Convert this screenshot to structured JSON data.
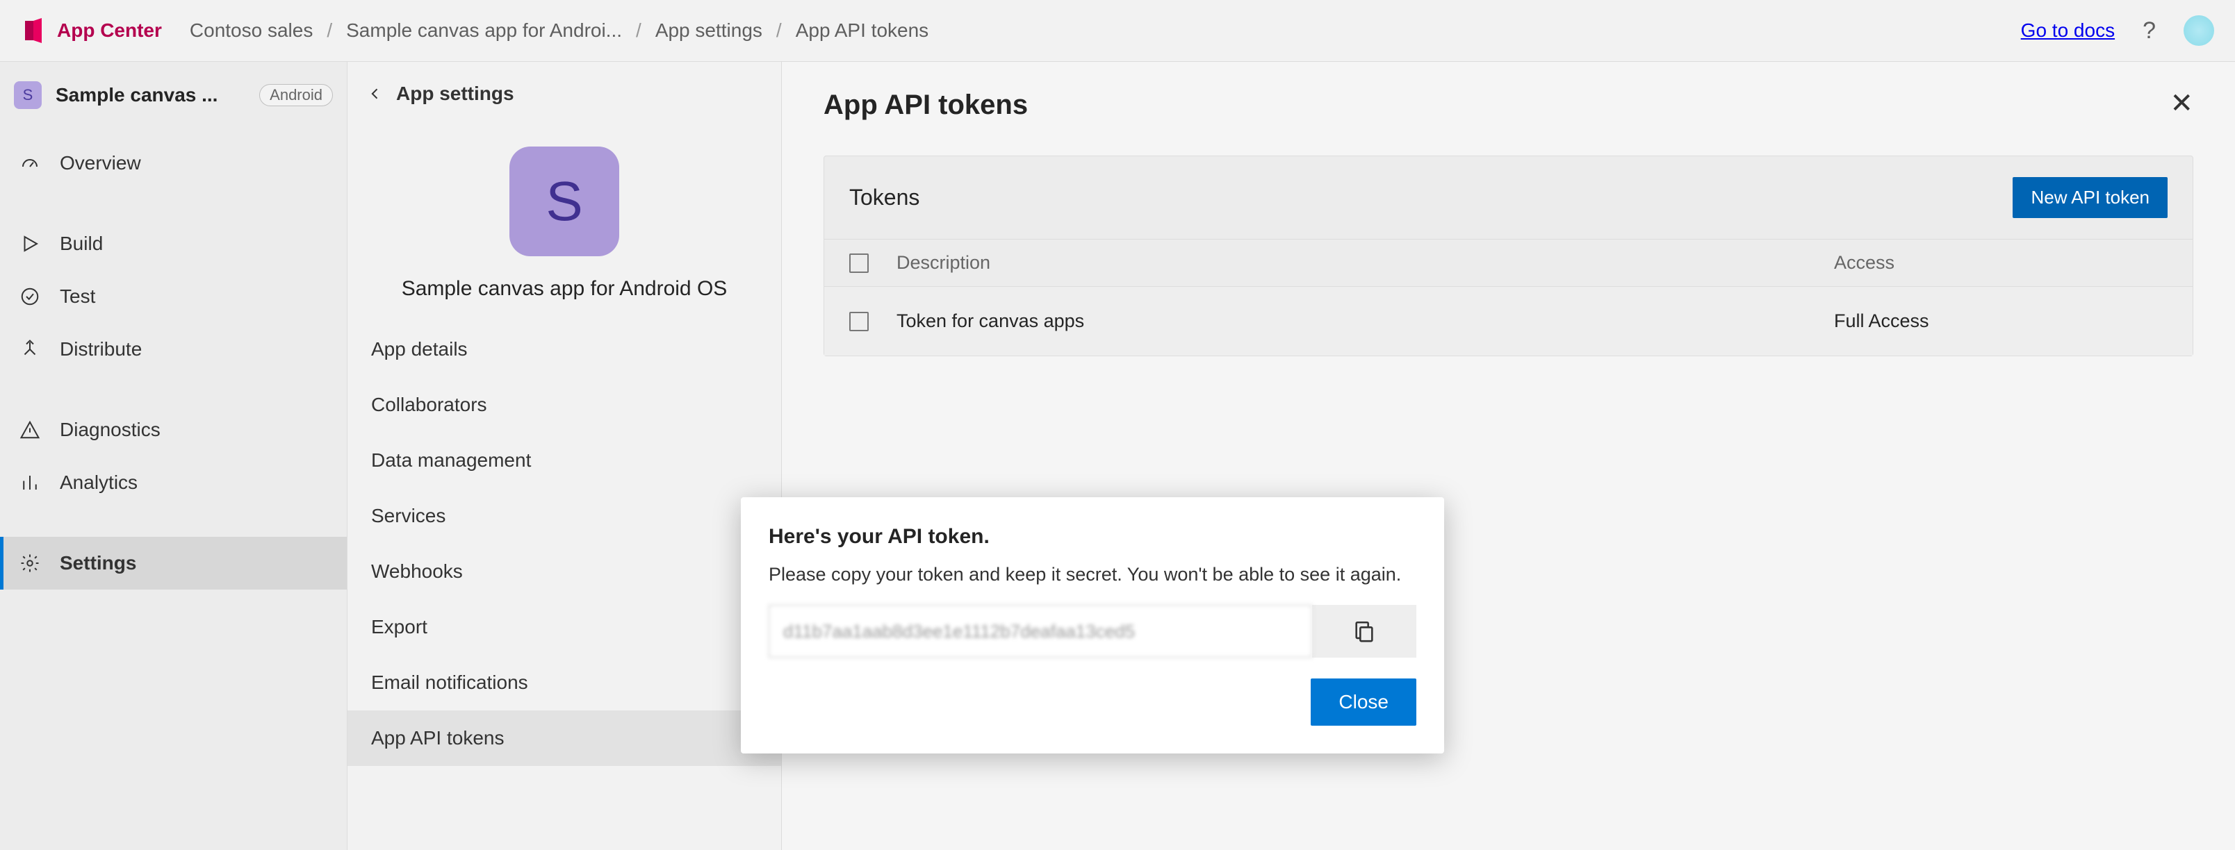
{
  "header": {
    "brand": "App Center",
    "crumbs": [
      "Contoso sales",
      "Sample canvas app for Androi...",
      "App settings",
      "App API tokens"
    ],
    "docs_label": "Go to docs"
  },
  "nav1": {
    "app_initial": "S",
    "app_title": "Sample canvas ...",
    "app_badge": "Android",
    "items": [
      {
        "label": "Overview",
        "icon": "speedometer"
      },
      {
        "label": "Build",
        "icon": "play"
      },
      {
        "label": "Test",
        "icon": "check-circle"
      },
      {
        "label": "Distribute",
        "icon": "distribute"
      },
      {
        "label": "Diagnostics",
        "icon": "warning"
      },
      {
        "label": "Analytics",
        "icon": "bar-chart"
      },
      {
        "label": "Settings",
        "icon": "gear",
        "active": true
      }
    ]
  },
  "nav2": {
    "back_label": "App settings",
    "app_initial": "S",
    "app_title": "Sample canvas app for Android OS",
    "items": [
      "App details",
      "Collaborators",
      "Data management",
      "Services",
      "Webhooks",
      "Export",
      "Email notifications",
      "App API tokens"
    ],
    "active_index": 7
  },
  "main": {
    "title": "App API tokens",
    "tokens_section_title": "Tokens",
    "new_token_button": "New API token",
    "columns": {
      "description": "Description",
      "access": "Access"
    },
    "rows": [
      {
        "description": "Token for canvas apps",
        "access": "Full Access"
      }
    ]
  },
  "modal": {
    "title": "Here's your API token.",
    "subtitle": "Please copy your token and keep it secret. You won't be able to see it again.",
    "token_value": "d11b7aa1aab8d3ee1e1112b7deafaa13ced5",
    "close_label": "Close"
  }
}
